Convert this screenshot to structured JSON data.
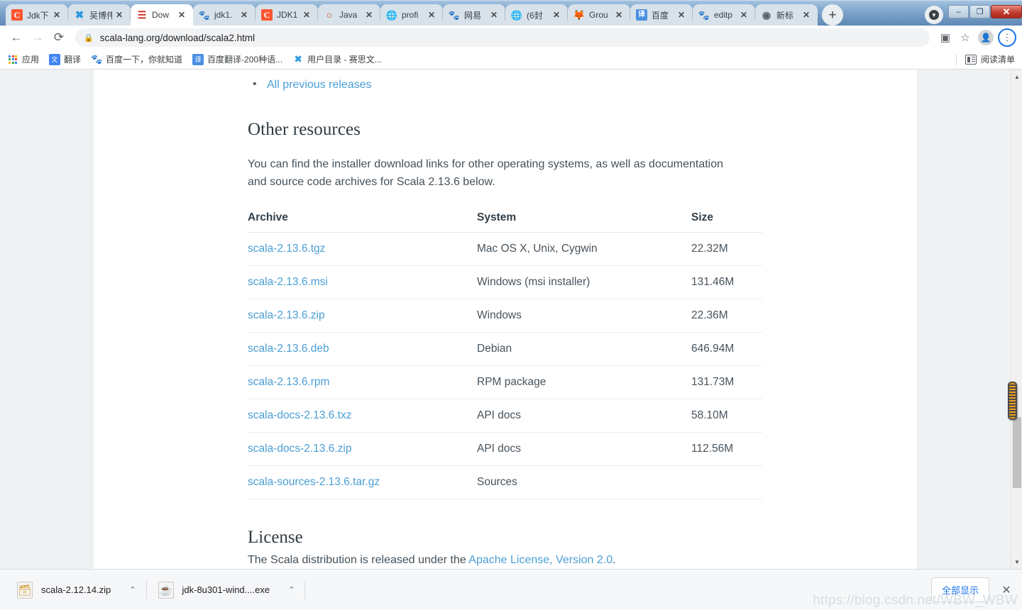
{
  "window": {
    "controls": {
      "minimize": "–",
      "maximize": "❐",
      "close": "✕"
    }
  },
  "tabs": [
    {
      "title": "Jdk下",
      "favicon": "csdn-icon",
      "glyph": "C",
      "active": false
    },
    {
      "title": "吴博伟",
      "favicon": "xmind-icon",
      "glyph": "✖",
      "active": false
    },
    {
      "title": "Dow",
      "favicon": "scala-icon",
      "glyph": "≡",
      "active": true
    },
    {
      "title": "jdk1.",
      "favicon": "baidu-icon",
      "glyph": "熊",
      "active": false
    },
    {
      "title": "JDK1",
      "favicon": "csdn-icon",
      "glyph": "C",
      "active": false
    },
    {
      "title": "Java",
      "favicon": "java-icon",
      "glyph": "○",
      "active": false
    },
    {
      "title": "profi",
      "favicon": "globe-icon",
      "glyph": "ἱ0",
      "active": false
    },
    {
      "title": "网易",
      "favicon": "baidu-icon",
      "glyph": "熊",
      "active": false
    },
    {
      "title": "(6封",
      "favicon": "globe-icon",
      "glyph": "ἱ0",
      "active": false
    },
    {
      "title": "Grou",
      "favicon": "gitlab-icon",
      "glyph": "ᾘa",
      "active": false
    },
    {
      "title": "百度",
      "favicon": "fanyi-icon",
      "glyph": "译",
      "active": false
    },
    {
      "title": "editp",
      "favicon": "baidu-icon",
      "glyph": "熊",
      "active": false
    },
    {
      "title": "新标",
      "favicon": "chrome-icon",
      "glyph": "◉",
      "active": false
    }
  ],
  "new_tab_label": "+",
  "toolbar": {
    "back": "←",
    "forward": "→",
    "reload": "⟳",
    "lock": "🔒",
    "url": "scala-lang.org/download/scala2.html",
    "translate_icon": "translate-icon",
    "bookmark_star": "☆",
    "profile": "👤",
    "menu": "⋮"
  },
  "bookmarks": {
    "items": [
      {
        "label": "应用",
        "icon": "apps-grid-icon"
      },
      {
        "label": "翻译",
        "icon": "google-translate-icon"
      },
      {
        "label": "百度一下，你就知道",
        "icon": "baidu-icon"
      },
      {
        "label": "百度翻译-200种语...",
        "icon": "fanyi-icon"
      },
      {
        "label": "用户目录 - 赛思文...",
        "icon": "xmind-icon"
      }
    ],
    "reading_list": "阅读清单"
  },
  "page": {
    "previous_releases_link": "All previous releases",
    "other_resources": {
      "heading": "Other resources",
      "body": "You can find the installer download links for other operating systems, as well as documentation and source code archives for Scala 2.13.6 below."
    },
    "table": {
      "headers": [
        "Archive",
        "System",
        "Size"
      ],
      "rows": [
        {
          "archive": "scala-2.13.6.tgz",
          "system": "Mac OS X, Unix, Cygwin",
          "size": "22.32M"
        },
        {
          "archive": "scala-2.13.6.msi",
          "system": "Windows (msi installer)",
          "size": "131.46M"
        },
        {
          "archive": "scala-2.13.6.zip",
          "system": "Windows",
          "size": "22.36M"
        },
        {
          "archive": "scala-2.13.6.deb",
          "system": "Debian",
          "size": "646.94M"
        },
        {
          "archive": "scala-2.13.6.rpm",
          "system": "RPM package",
          "size": "131.73M"
        },
        {
          "archive": "scala-docs-2.13.6.txz",
          "system": "API docs",
          "size": "58.10M"
        },
        {
          "archive": "scala-docs-2.13.6.zip",
          "system": "API docs",
          "size": "112.56M"
        },
        {
          "archive": "scala-sources-2.13.6.tar.gz",
          "system": "Sources",
          "size": ""
        }
      ]
    },
    "license": {
      "heading": "License",
      "body_prefix": "The Scala distribution is released under the ",
      "link": "Apache License, Version 2.0",
      "body_suffix": "."
    }
  },
  "downloads": {
    "items": [
      {
        "name": "scala-2.12.14.zip",
        "icon": "zip-file-icon",
        "caret": "⌃"
      },
      {
        "name": "jdk-8u301-wind....exe",
        "icon": "java-file-icon",
        "caret": "⌃"
      }
    ],
    "show_all": "全部显示",
    "close": "✕"
  },
  "watermark": "https://blog.csdn.net/WBW_WBW",
  "colors": {
    "link": "#4a9ed4",
    "tab_strip": "#5d89b5",
    "accent_blue": "#1a73e8",
    "page_bg": "#ffffff",
    "viewport_bg": "#eff2f3"
  }
}
